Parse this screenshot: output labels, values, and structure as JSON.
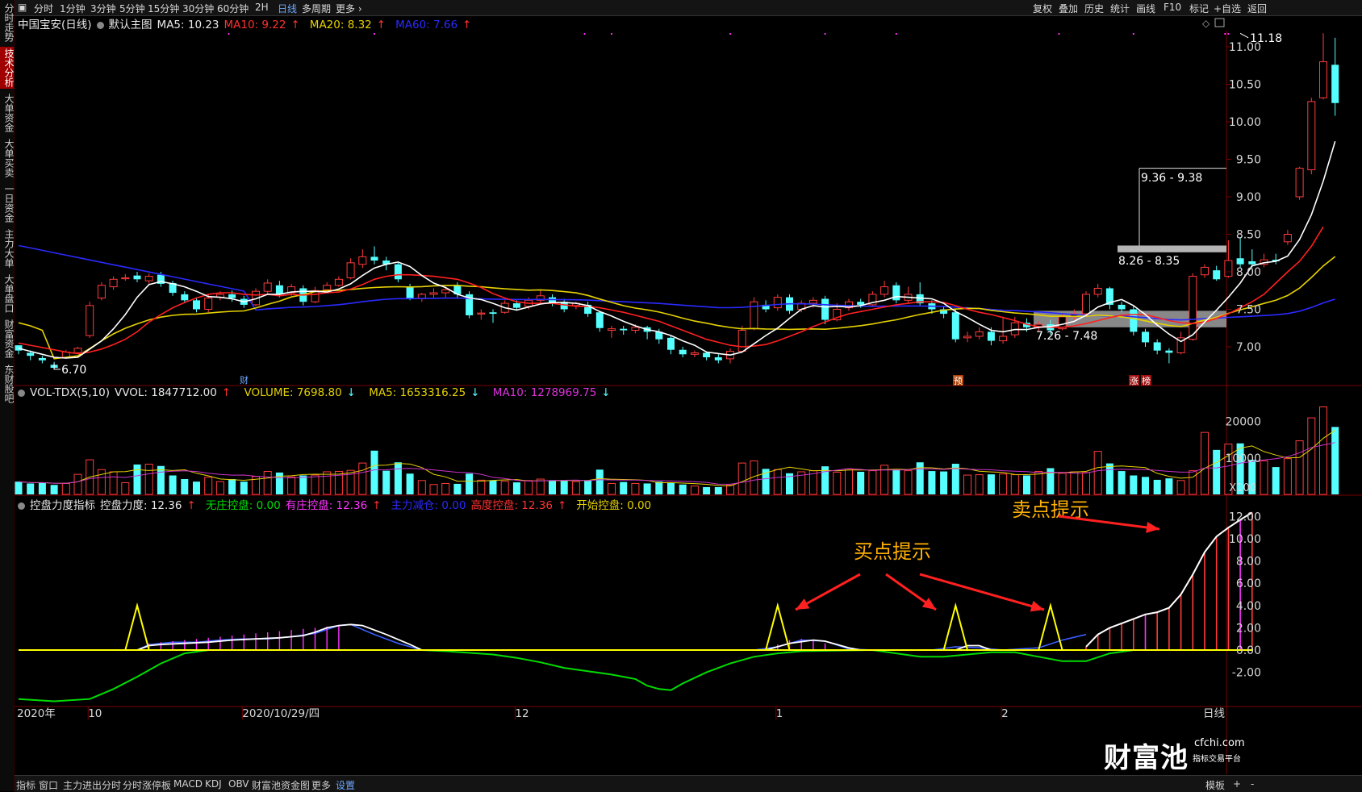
{
  "left_tabs": [
    {
      "label": "分时走势",
      "active": false
    },
    {
      "label": "技术分析",
      "active": true
    },
    {
      "label": "大单资金",
      "active": false
    },
    {
      "label": "大单买卖",
      "active": false
    },
    {
      "label": "一日资金",
      "active": false
    },
    {
      "label": "主力大单",
      "active": false
    },
    {
      "label": "大单盘口",
      "active": false
    },
    {
      "label": "财富资金",
      "active": false
    },
    {
      "label": "东财股吧",
      "active": false
    }
  ],
  "top_tabs": [
    {
      "label": "分时",
      "active": false
    },
    {
      "label": "1分钟",
      "active": false
    },
    {
      "label": "3分钟",
      "active": false
    },
    {
      "label": "5分钟",
      "active": false
    },
    {
      "label": "15分钟",
      "active": false
    },
    {
      "label": "30分钟",
      "active": false
    },
    {
      "label": "60分钟",
      "active": false
    },
    {
      "label": "2H",
      "active": false
    },
    {
      "label": "日线",
      "active": true
    },
    {
      "label": "多周期",
      "active": false
    },
    {
      "label": "更多",
      "active": false
    }
  ],
  "top_right": [
    "复权",
    "叠加",
    "历史",
    "统计",
    "画线",
    "F10",
    "标记",
    "+自选",
    "返回"
  ],
  "bottom_tabs": [
    "指标",
    "窗口",
    "主力进出分时",
    "分时涨停板",
    "MACD",
    "KDJ",
    "OBV",
    "财富池资金图",
    "更多",
    "设置"
  ],
  "bottom_right": [
    "模板",
    "+",
    "-"
  ],
  "main_legend": {
    "name": "中国宝安(日线)",
    "template": "默认主图",
    "ma5": "MA5: 10.23",
    "ma10": "MA10: 9.22",
    "ma20": "MA20: 8.32",
    "ma60": "MA60: 7.66",
    "up": "↑"
  },
  "vol_legend": {
    "name": "VOL-TDX(5,10)",
    "vvol": "VVOL: 1847712.00",
    "volume": "VOLUME: 7698.80",
    "ma5": "MA5: 1653316.25",
    "ma10": "MA10: 1278969.75",
    "up": "↑",
    "down": "↓"
  },
  "ind_legend": {
    "name": "控盘力度指标",
    "strength": "控盘力度: 12.36",
    "none": "无庄控盘: 0.00",
    "has": "有庄控盘: 12.36",
    "reduce": "主力减仓: 0.00",
    "high": "高度控盘: 12.36",
    "start": "开始控盘: 0.00",
    "up": "↑"
  },
  "price_axis": [
    "11.00",
    "10.50",
    "10.00",
    "9.50",
    "9.00",
    "8.50",
    "8.00",
    "7.50",
    "7.00"
  ],
  "vol_axis": [
    "20000",
    "10000",
    "X100"
  ],
  "ind_axis": [
    "12.00",
    "10.00",
    "8.00",
    "6.00",
    "4.00",
    "2.00",
    "0.00",
    "-2.00"
  ],
  "x_axis": [
    {
      "label": "2020年",
      "slot": 0
    },
    {
      "label": "10",
      "slot": 6
    },
    {
      "label": "2020/10/29/四",
      "slot": 19
    },
    {
      "label": "12",
      "slot": 42
    },
    {
      "label": "1",
      "slot": 64
    },
    {
      "label": "2",
      "slot": 83
    },
    {
      "label": "日线",
      "slot": 100
    }
  ],
  "annotations": {
    "low": "6.70",
    "high": "11.18",
    "zone1": "7.26 - 7.48",
    "zone2": "8.26 - 8.35",
    "zone3": "9.36 - 9.38",
    "buy": "买点提示",
    "sell": "卖点提示",
    "mark_cai": "财",
    "mark_yu": "预",
    "mark_zhang": "涨",
    "mark_bang": "榜"
  },
  "logo": {
    "name": "财富池",
    "site": "cfchi.com",
    "tagline": "指标交易平台"
  },
  "colors": {
    "up": "#ff3b3b",
    "down": "#55ffff",
    "ma5": "#ffffff",
    "ma10": "#ff2020",
    "ma20": "#e6d200",
    "ma60": "#2a2aff",
    "green": "#00dd00",
    "magenta": "#ff33ff",
    "yellow": "#ffff00",
    "blue": "#3a5fff",
    "orange": "#ffb000"
  },
  "chart_data": {
    "type": "candlestick",
    "title": "中国宝安(日线)",
    "ylim": [
      6.55,
      11.35
    ],
    "candles": [
      [
        7.02,
        6.95,
        7.02,
        6.9
      ],
      [
        6.92,
        6.88,
        6.95,
        6.82
      ],
      [
        6.85,
        6.82,
        6.88,
        6.78
      ],
      [
        6.76,
        6.72,
        6.8,
        6.7
      ],
      [
        6.86,
        6.93,
        6.96,
        6.84
      ],
      [
        6.92,
        6.98,
        7.0,
        6.9
      ],
      [
        7.15,
        7.55,
        7.6,
        7.12
      ],
      [
        7.65,
        7.82,
        7.86,
        7.62
      ],
      [
        7.8,
        7.9,
        7.94,
        7.76
      ],
      [
        7.92,
        7.92,
        7.97,
        7.88
      ],
      [
        7.95,
        7.9,
        8.0,
        7.86
      ],
      [
        7.88,
        7.94,
        7.98,
        7.84
      ],
      [
        7.96,
        7.84,
        8.0,
        7.8
      ],
      [
        7.85,
        7.72,
        7.88,
        7.68
      ],
      [
        7.7,
        7.62,
        7.74,
        7.58
      ],
      [
        7.62,
        7.5,
        7.66,
        7.46
      ],
      [
        7.5,
        7.65,
        7.7,
        7.46
      ],
      [
        7.66,
        7.7,
        7.74,
        7.62
      ],
      [
        7.7,
        7.65,
        7.75,
        7.6
      ],
      [
        7.64,
        7.56,
        7.68,
        7.52
      ],
      [
        7.56,
        7.74,
        7.78,
        7.54
      ],
      [
        7.74,
        7.85,
        7.9,
        7.7
      ],
      [
        7.82,
        7.7,
        7.88,
        7.66
      ],
      [
        7.72,
        7.8,
        7.84,
        7.68
      ],
      [
        7.78,
        7.6,
        7.82,
        7.55
      ],
      [
        7.6,
        7.75,
        7.8,
        7.58
      ],
      [
        7.76,
        7.82,
        7.86,
        7.72
      ],
      [
        7.82,
        7.9,
        7.94,
        7.8
      ],
      [
        7.92,
        8.12,
        8.18,
        7.9
      ],
      [
        8.1,
        8.2,
        8.3,
        8.05
      ],
      [
        8.2,
        8.15,
        8.34,
        8.1
      ],
      [
        8.15,
        8.1,
        8.2,
        8.02
      ],
      [
        8.1,
        7.9,
        8.12,
        7.86
      ],
      [
        7.8,
        7.65,
        7.84,
        7.62
      ],
      [
        7.64,
        7.7,
        7.72,
        7.6
      ],
      [
        7.7,
        7.72,
        7.78,
        7.64
      ],
      [
        7.72,
        7.76,
        7.8,
        7.66
      ],
      [
        7.82,
        7.7,
        7.86,
        7.64
      ],
      [
        7.7,
        7.42,
        7.74,
        7.38
      ],
      [
        7.44,
        7.45,
        7.5,
        7.36
      ],
      [
        7.46,
        7.44,
        7.5,
        7.32
      ],
      [
        7.46,
        7.58,
        7.62,
        7.44
      ],
      [
        7.58,
        7.52,
        7.62,
        7.48
      ],
      [
        7.54,
        7.62,
        7.66,
        7.5
      ],
      [
        7.62,
        7.68,
        7.76,
        7.58
      ],
      [
        7.66,
        7.58,
        7.7,
        7.54
      ],
      [
        7.6,
        7.5,
        7.64,
        7.46
      ],
      [
        7.55,
        7.58,
        7.6,
        7.5
      ],
      [
        7.56,
        7.44,
        7.6,
        7.4
      ],
      [
        7.46,
        7.25,
        7.48,
        7.2
      ],
      [
        7.22,
        7.24,
        7.28,
        7.12
      ],
      [
        7.24,
        7.22,
        7.28,
        7.16
      ],
      [
        7.22,
        7.26,
        7.3,
        7.18
      ],
      [
        7.26,
        7.2,
        7.28,
        7.1
      ],
      [
        7.2,
        7.1,
        7.24,
        7.04
      ],
      [
        7.12,
        6.96,
        7.14,
        6.9
      ],
      [
        6.96,
        6.9,
        7.0,
        6.86
      ],
      [
        6.9,
        6.92,
        6.95,
        6.86
      ],
      [
        6.92,
        6.86,
        6.94,
        6.82
      ],
      [
        6.86,
        6.82,
        6.9,
        6.78
      ],
      [
        6.84,
        6.94,
        6.98,
        6.78
      ],
      [
        6.94,
        7.22,
        7.28,
        6.92
      ],
      [
        7.24,
        7.6,
        7.66,
        7.22
      ],
      [
        7.56,
        7.5,
        7.62,
        7.46
      ],
      [
        7.52,
        7.66,
        7.7,
        7.48
      ],
      [
        7.66,
        7.48,
        7.7,
        7.44
      ],
      [
        7.5,
        7.58,
        7.62,
        7.46
      ],
      [
        7.58,
        7.62,
        7.66,
        7.52
      ],
      [
        7.64,
        7.36,
        7.68,
        7.3
      ],
      [
        7.36,
        7.5,
        7.58,
        7.34
      ],
      [
        7.52,
        7.6,
        7.64,
        7.48
      ],
      [
        7.6,
        7.56,
        7.64,
        7.52
      ],
      [
        7.56,
        7.7,
        7.74,
        7.54
      ],
      [
        7.7,
        7.8,
        7.88,
        7.66
      ],
      [
        7.82,
        7.62,
        7.86,
        7.58
      ],
      [
        7.62,
        7.7,
        7.8,
        7.58
      ],
      [
        7.7,
        7.58,
        7.86,
        7.54
      ],
      [
        7.58,
        7.5,
        7.62,
        7.44
      ],
      [
        7.5,
        7.44,
        7.54,
        7.38
      ],
      [
        7.46,
        7.1,
        7.5,
        7.06
      ],
      [
        7.12,
        7.14,
        7.2,
        7.06
      ],
      [
        7.14,
        7.2,
        7.26,
        7.1
      ],
      [
        7.2,
        7.08,
        7.26,
        7.02
      ],
      [
        7.08,
        7.14,
        7.4,
        7.04
      ],
      [
        7.16,
        7.32,
        7.4,
        7.12
      ],
      [
        7.32,
        7.26,
        7.38,
        7.2
      ],
      [
        7.26,
        7.3,
        7.34,
        7.2
      ],
      [
        7.3,
        7.22,
        7.36,
        7.16
      ],
      [
        7.24,
        7.4,
        7.44,
        7.22
      ],
      [
        7.4,
        7.44,
        7.5,
        7.36
      ],
      [
        7.44,
        7.7,
        7.74,
        7.4
      ],
      [
        7.7,
        7.78,
        7.84,
        7.66
      ],
      [
        7.78,
        7.56,
        7.8,
        7.5
      ],
      [
        7.56,
        7.5,
        7.6,
        7.46
      ],
      [
        7.5,
        7.2,
        7.55,
        7.15
      ],
      [
        7.2,
        7.06,
        7.24,
        7.0
      ],
      [
        7.06,
        6.95,
        7.1,
        6.9
      ],
      [
        6.95,
        6.92,
        6.98,
        6.78
      ],
      [
        6.92,
        7.12,
        7.2,
        6.9
      ],
      [
        7.1,
        7.94,
        7.98,
        7.08
      ],
      [
        7.96,
        8.06,
        8.1,
        7.92
      ],
      [
        8.02,
        7.9,
        8.08,
        7.88
      ],
      [
        7.94,
        8.15,
        8.42,
        7.92
      ],
      [
        8.18,
        8.1,
        8.46,
        8.06
      ],
      [
        8.14,
        8.1,
        8.3,
        8.06
      ],
      [
        8.1,
        8.16,
        8.24,
        8.06
      ],
      [
        8.16,
        8.14,
        8.24,
        8.1
      ],
      [
        8.4,
        8.5,
        8.56,
        8.36
      ],
      [
        9.0,
        9.38,
        9.4,
        8.96
      ],
      [
        9.36,
        10.27,
        10.32,
        9.3
      ],
      [
        10.32,
        10.8,
        11.18,
        10.3
      ],
      [
        10.76,
        10.25,
        11.12,
        10.08
      ]
    ],
    "ma5": [
      6.98,
      6.94,
      6.9,
      6.86,
      6.85,
      6.86,
      6.97,
      7.08,
      7.24,
      7.43,
      7.66,
      7.83,
      7.87,
      7.84,
      7.8,
      7.74,
      7.67,
      7.66,
      7.64,
      7.6,
      7.64,
      7.7,
      7.7,
      7.73,
      7.74,
      7.74,
      7.73,
      7.77,
      7.84,
      7.95,
      8.05,
      8.1,
      8.13,
      8.07,
      7.95,
      7.85,
      7.79,
      7.7,
      7.65,
      7.63,
      7.58,
      7.52,
      7.49,
      7.53,
      7.57,
      7.59,
      7.59,
      7.58,
      7.55,
      7.47,
      7.41,
      7.34,
      7.28,
      7.23,
      7.2,
      7.15,
      7.08,
      7.02,
      6.93,
      6.91,
      6.89,
      6.93,
      7.04,
      7.15,
      7.25,
      7.38,
      7.5,
      7.55,
      7.53,
      7.54,
      7.53,
      7.55,
      7.59,
      7.62,
      7.67,
      7.66,
      7.65,
      7.64,
      7.58,
      7.47,
      7.39,
      7.3,
      7.22,
      7.2,
      7.23,
      7.23,
      7.26,
      7.27,
      7.3,
      7.34,
      7.42,
      7.53,
      7.59,
      7.63,
      7.55,
      7.43,
      7.29,
      7.17,
      7.07,
      7.16,
      7.33,
      7.49,
      7.66,
      7.85,
      8.08,
      8.12,
      8.14,
      8.21,
      8.43,
      8.76,
      9.21,
      9.74
    ],
    "ma10": [
      7.05,
      7.02,
      6.99,
      6.96,
      6.93,
      6.91,
      6.93,
      6.97,
      7.03,
      7.1,
      7.2,
      7.33,
      7.43,
      7.52,
      7.59,
      7.65,
      7.7,
      7.72,
      7.72,
      7.7,
      7.69,
      7.7,
      7.68,
      7.7,
      7.69,
      7.7,
      7.72,
      7.73,
      7.77,
      7.83,
      7.9,
      7.94,
      7.96,
      7.96,
      7.95,
      7.94,
      7.92,
      7.9,
      7.85,
      7.79,
      7.71,
      7.65,
      7.6,
      7.58,
      7.58,
      7.58,
      7.56,
      7.54,
      7.54,
      7.52,
      7.49,
      7.46,
      7.42,
      7.38,
      7.34,
      7.28,
      7.22,
      7.16,
      7.1,
      7.06,
      7.02,
      7.0,
      7.01,
      7.03,
      7.08,
      7.14,
      7.2,
      7.27,
      7.33,
      7.39,
      7.44,
      7.47,
      7.5,
      7.53,
      7.56,
      7.58,
      7.6,
      7.6,
      7.59,
      7.55,
      7.5,
      7.46,
      7.43,
      7.39,
      7.35,
      7.3,
      7.27,
      7.26,
      7.26,
      7.28,
      7.31,
      7.35,
      7.39,
      7.42,
      7.43,
      7.43,
      7.39,
      7.35,
      7.32,
      7.31,
      7.33,
      7.38,
      7.44,
      7.52,
      7.6,
      7.7,
      7.85,
      8.0,
      8.14,
      8.34,
      8.6
    ]
  }
}
